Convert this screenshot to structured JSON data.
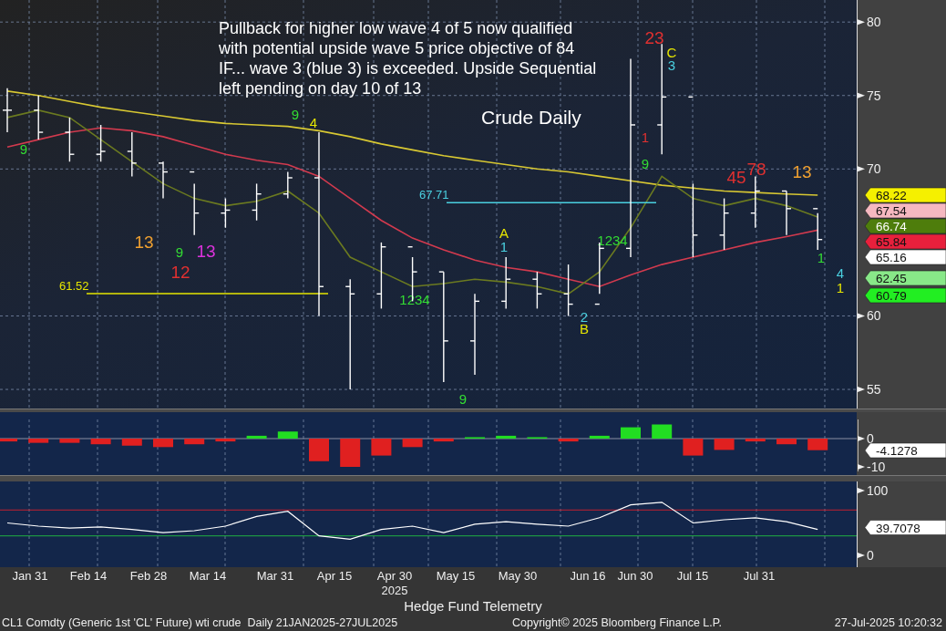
{
  "chart": {
    "note_lines": [
      "Pullback for higher low wave 4 of 5 now qualified",
      "with potential upside wave 5 price objective of 84",
      "IF... wave 3 (blue 3) is exceeded.  Upside Sequential",
      "left pending on day 10 of 13"
    ],
    "title": "Crude Daily",
    "chart_data": {
      "type": "line",
      "grid": true,
      "ylim": [
        53.7,
        81.5
      ],
      "yticks": [
        55,
        60,
        70,
        75,
        80
      ],
      "series": [
        {
          "color": "#d8c832",
          "values": [
            75.3,
            75,
            74.6,
            74.2,
            73.9,
            73.6,
            73.3,
            73.1,
            73,
            72.9,
            72.6,
            72.2,
            71.7,
            71.3,
            70.9,
            70.6,
            70.3,
            70,
            69.8,
            69.5,
            69.2,
            68.9,
            68.7,
            68.5,
            68.4,
            68.3,
            68.22
          ]
        },
        {
          "color": "#d23a4e",
          "values": [
            71.5,
            72,
            72.5,
            72.8,
            72.6,
            72.2,
            71.6,
            71,
            70.6,
            70.3,
            69.5,
            68,
            66.5,
            65.3,
            64.5,
            63.8,
            63.3,
            63,
            62.5,
            62,
            62.8,
            63.5,
            64,
            64.5,
            65,
            65.4,
            65.84
          ]
        },
        {
          "color": "#6b7a20",
          "values": [
            73.5,
            74,
            73.5,
            72,
            70.5,
            69,
            68,
            67.5,
            67.8,
            68.5,
            67,
            64,
            63,
            62,
            62.2,
            62.5,
            62.3,
            62,
            61.5,
            63,
            66,
            69.5,
            68,
            67.5,
            68,
            67.5,
            66.74
          ]
        }
      ]
    },
    "levels": [
      {
        "text": "61.52",
        "color": "#e6e600"
      },
      {
        "text": "67.71",
        "color": "#4ad0e0"
      }
    ],
    "counts": [
      {
        "text": "9",
        "color": "#33dd33"
      },
      {
        "text": "13",
        "color": "#f0a030"
      },
      {
        "text": "9",
        "color": "#33dd33"
      },
      {
        "text": "13",
        "color": "#dd33dd"
      },
      {
        "text": "12",
        "color": "#e03030"
      },
      {
        "text": "9",
        "color": "#33dd33"
      },
      {
        "text": "4",
        "color": "#e6e600"
      },
      {
        "text": "1234",
        "color": "#33dd33"
      },
      {
        "text": "9",
        "color": "#33dd33"
      },
      {
        "text": "A",
        "color": "#e6e600"
      },
      {
        "text": "1",
        "color": "#4ad0e0"
      },
      {
        "text": "2",
        "color": "#4ad0e0"
      },
      {
        "text": "B",
        "color": "#e6e600"
      },
      {
        "text": "1234",
        "color": "#33dd33"
      },
      {
        "text": "1",
        "color": "#e03030"
      },
      {
        "text": "9",
        "color": "#33dd33"
      },
      {
        "text": "23",
        "color": "#e03030"
      },
      {
        "text": "C",
        "color": "#e6e600"
      },
      {
        "text": "3",
        "color": "#4ad0e0"
      },
      {
        "text": "45",
        "color": "#e03030"
      },
      {
        "text": "78",
        "color": "#e03030"
      },
      {
        "text": "13",
        "color": "#f0a030"
      },
      {
        "text": "1",
        "color": "#33dd33"
      },
      {
        "text": "4",
        "color": "#4ad0e0"
      },
      {
        "text": "1",
        "color": "#e6e600"
      }
    ],
    "value_tags": [
      {
        "text": "68.22",
        "color": "#f5f000"
      },
      {
        "text": "67.54",
        "color": "#f6b8c0"
      },
      {
        "text": "66.74",
        "color": "#4e7d0c"
      },
      {
        "text": "65.84",
        "color": "#e8203c"
      },
      {
        "text": "65.16",
        "color": "#ffffff"
      },
      {
        "text": "62.45",
        "color": "#88e888"
      },
      {
        "text": "60.79",
        "color": "#22ee22"
      }
    ]
  },
  "oscillator_1": {
    "axis": [
      "0",
      "-10"
    ],
    "value_tag": "-4.1278"
  },
  "oscillator_2": {
    "axis": [
      "100",
      "0"
    ],
    "value_tag": "39.7078"
  },
  "dates": {
    "labels": [
      "Jan 31",
      "Feb 14",
      "Feb 28",
      "Mar 14",
      "Mar 31",
      "Apr 15",
      "Apr 30",
      "May 15",
      "May 30",
      "Jun 16",
      "Jun 30",
      "Jul 15",
      "Jul 31"
    ],
    "year": "2025"
  },
  "footer": {
    "caption": "Hedge Fund Telemetry",
    "security": "CL1 Comdty (Generic 1st 'CL' Future) wti crude  Daily 21JAN2025-27JUL2025",
    "copyright": "Copyright© 2025 Bloomberg Finance L.P.",
    "timestamp": "27-Jul-2025 10:20:32"
  }
}
